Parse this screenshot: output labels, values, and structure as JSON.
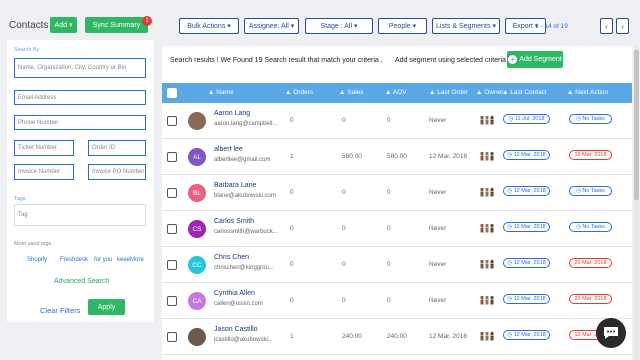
{
  "header": {
    "title": "Contacts",
    "add_label": "Add",
    "sync_label": "Sync Summary",
    "sync_badge": "1",
    "filters": {
      "bulk_actions": "Bulk Actions",
      "assignee": "Assignee: All",
      "stage": "Stage : All",
      "people": "People",
      "lists_segments": "Lists & Segments",
      "export": "Export"
    },
    "pagination": "1 - 14 of 19",
    "prev_icon": "‹",
    "next_icon": "›"
  },
  "sidebar": {
    "search_by_label": "Search By",
    "name_placeholder": "Name, Organization, City, Country or Bio",
    "email_placeholder": "Email Address",
    "phone_placeholder": "Phone Number",
    "ticket_placeholder": "Ticket Number",
    "order_placeholder": "Order ID",
    "invoice_placeholder": "Invoice Number",
    "invoice_po_placeholder": "Invoice PO Number",
    "tags_label": "Tags",
    "tags_placeholder": "Tag",
    "most_used_tags_label": "Most used tags",
    "tags": [
      "Shopify",
      "Freshdesk",
      "for you",
      "keeeMore"
    ],
    "advanced_search": "Advanced Search",
    "clear_filters": "Clear Filters",
    "apply": "Apply"
  },
  "main": {
    "results_text": "Search results ! We Found 19 Search result that match your criteria .",
    "segment_text": "Add segment using selected criteria",
    "add_segment_button": "Add Segment",
    "columns": {
      "name": "Name",
      "orders": "Orders",
      "sales": "Sales",
      "aov": "AOV",
      "last_order": "Last Order",
      "owner": "Owner",
      "last_contact": "Last Contact",
      "next_action": "Next Action"
    },
    "rows": [
      {
        "name": "Aaron Lang",
        "email": "aaron.lang@campbell...",
        "initials": "",
        "avatar_color": "#8a6a55",
        "orders": "0",
        "sales": "0",
        "aov": "0",
        "last_order": "Never",
        "last_contact": "11 Jul, 2018",
        "next_action": "No Tasks",
        "next_action_style": "blue"
      },
      {
        "name": "albert lee",
        "email": "albertlee@gmail.com",
        "initials": "AL",
        "avatar_color": "#7e57c2",
        "orders": "1",
        "sales": "580.00",
        "aov": "580.00",
        "last_order": "12 Mar, 2018",
        "last_contact": "12 Mar, 2018",
        "next_action": "15 Mar, 2018",
        "next_action_style": "red"
      },
      {
        "name": "Barbara Lane",
        "email": "blane@akubowski.com",
        "initials": "BL",
        "avatar_color": "#ec5f7e",
        "orders": "0",
        "sales": "0",
        "aov": "0",
        "last_order": "Never",
        "last_contact": "12 Mar, 2018",
        "next_action": "No Tasks",
        "next_action_style": "blue"
      },
      {
        "name": "Carlos Smith",
        "email": "carlossmith@warbuck...",
        "initials": "CS",
        "avatar_color": "#9c27b0",
        "orders": "0",
        "sales": "0",
        "aov": "0",
        "last_order": "Never",
        "last_contact": "12 Mar, 2018",
        "next_action": "No Tasks",
        "next_action_style": "blue"
      },
      {
        "name": "Chris Chen",
        "email": "chrischen@kinggrou...",
        "initials": "CC",
        "avatar_color": "#26c6da",
        "orders": "0",
        "sales": "0",
        "aov": "0",
        "last_order": "Never",
        "last_contact": "12 Mar, 2018",
        "next_action": "20 Mar, 2018",
        "next_action_style": "red"
      },
      {
        "name": "Cynthia Allen",
        "email": "callen@ossin.com",
        "initials": "CA",
        "avatar_color": "#c678dd",
        "orders": "0",
        "sales": "0",
        "aov": "0",
        "last_order": "Never",
        "last_contact": "12 Mar, 2018",
        "next_action": "20 Mar, 2018",
        "next_action_style": "red"
      },
      {
        "name": "Jason Castillo",
        "email": "jcastillo@akubowski...",
        "initials": "",
        "avatar_color": "#6d5a4c",
        "orders": "1",
        "sales": "240.00",
        "aov": "240.00",
        "last_order": "12 Mar, 2018",
        "last_contact": "12 Mar, 2018",
        "next_action": "12 Mar, 2018",
        "next_action_style": "red"
      }
    ]
  }
}
